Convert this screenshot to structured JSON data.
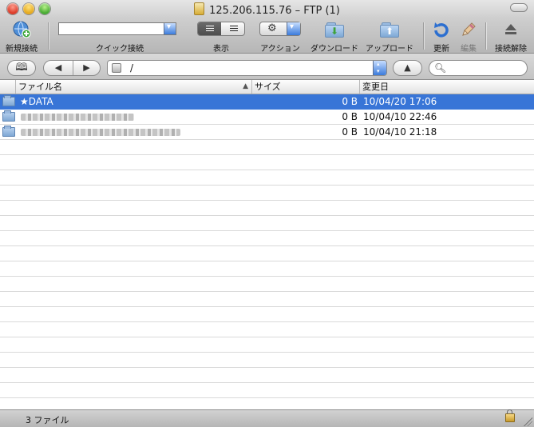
{
  "window": {
    "title": "125.206.115.76 – FTP (1)"
  },
  "toolbar": {
    "new_connection": "新規接続",
    "quick_connect": "クイック接続",
    "view": "表示",
    "action": "アクション",
    "download": "ダウンロード",
    "upload": "アップロード",
    "refresh": "更新",
    "edit": "編集",
    "disconnect": "接続解除"
  },
  "pathbar": {
    "path": "/"
  },
  "table": {
    "columns": {
      "name": "ファイル名",
      "size": "サイズ",
      "modified": "変更日"
    },
    "rows": [
      {
        "name": "★DATA",
        "size": "0 B",
        "modified": "10/04/20 17:06",
        "selected": true
      },
      {
        "name": "",
        "size": "0 B",
        "modified": "10/04/10 22:46",
        "selected": false
      },
      {
        "name": "",
        "size": "0 B",
        "modified": "10/04/10 21:18",
        "selected": false
      }
    ]
  },
  "status": {
    "text": "3 ファイル"
  },
  "colors": {
    "selection": "#3875d7"
  }
}
